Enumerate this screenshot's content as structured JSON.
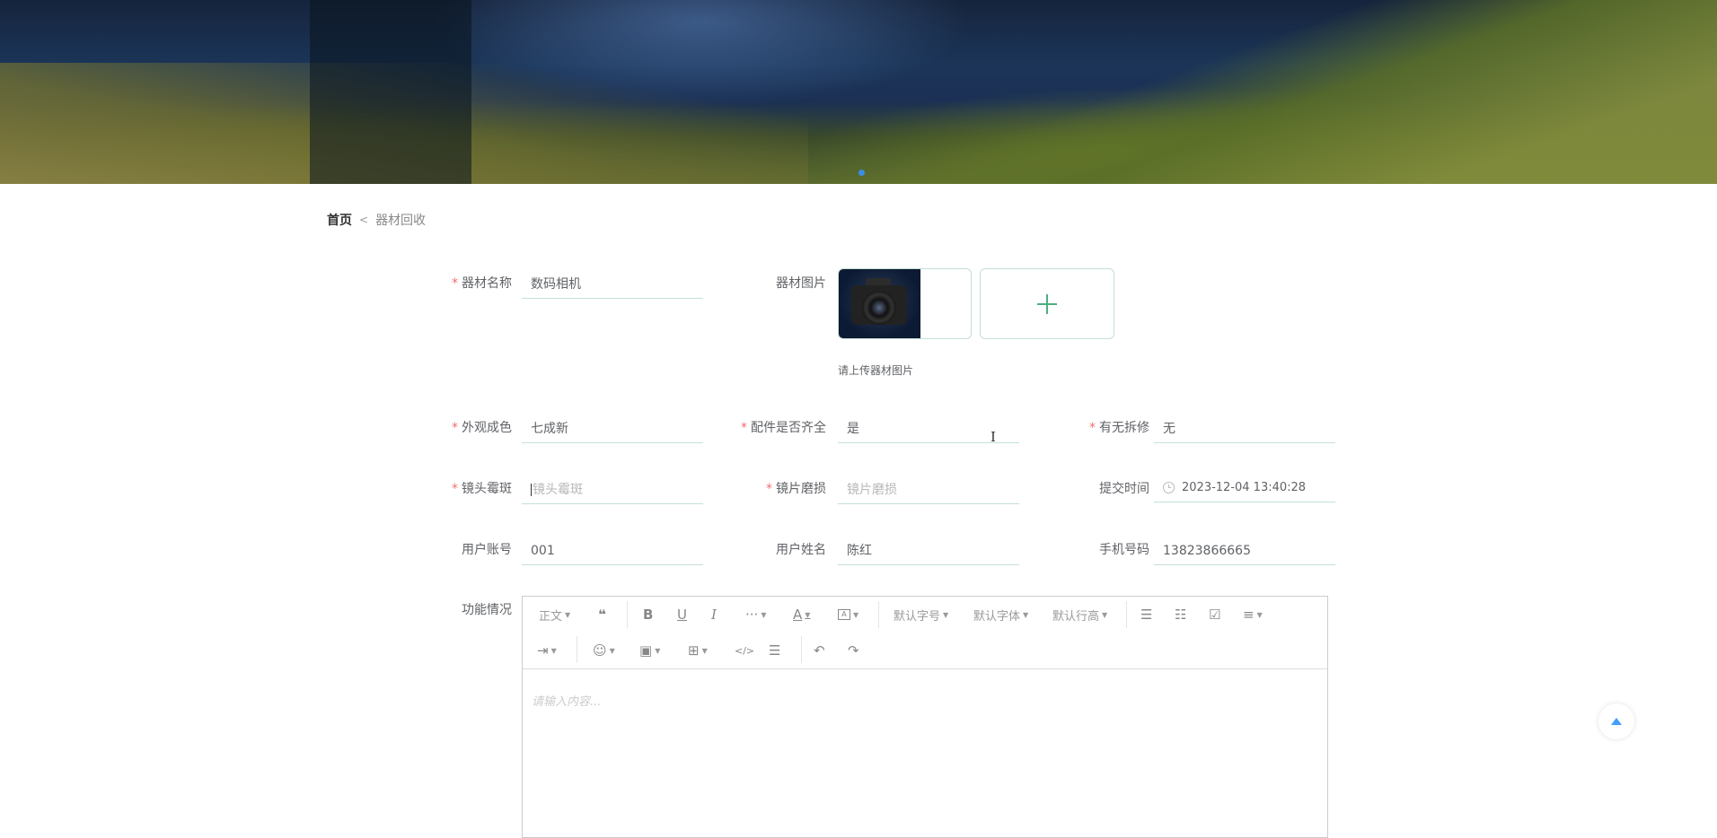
{
  "breadcrumb": {
    "home": "首页",
    "separator": "<",
    "current": "器材回收"
  },
  "form": {
    "equipment_name": {
      "label": "器材名称",
      "value": "数码相机",
      "required": true
    },
    "equipment_image": {
      "label": "器材图片",
      "tip": "请上传器材图片",
      "upload_icon": "plus-icon"
    },
    "appearance": {
      "label": "外观成色",
      "value": "七成新",
      "required": true
    },
    "accessories": {
      "label": "配件是否齐全",
      "value": "是",
      "required": true
    },
    "disassembly": {
      "label": "有无拆修",
      "value": "无",
      "required": true
    },
    "lens_mold": {
      "label": "镜头霉斑",
      "placeholder": "镜头霉斑",
      "required": true
    },
    "lens_wear": {
      "label": "镜片磨损",
      "placeholder": "镜片磨损",
      "required": true
    },
    "submit_time": {
      "label": "提交时间",
      "value": "2023-12-04 13:40:28"
    },
    "user_account": {
      "label": "用户账号",
      "value": "001"
    },
    "user_name": {
      "label": "用户姓名",
      "value": "陈红"
    },
    "phone": {
      "label": "手机号码",
      "value": "13823866665"
    },
    "function": {
      "label": "功能情况"
    }
  },
  "editor": {
    "toolbar": {
      "paragraph": "正文",
      "font_size": "默认字号",
      "font_family": "默认字体",
      "line_height": "默认行高"
    },
    "placeholder": "请输入内容..."
  },
  "colors": {
    "accent": "#409eff",
    "required": "#f56c6c",
    "border": "#c4e0d4",
    "plus": "#4caf7f"
  }
}
